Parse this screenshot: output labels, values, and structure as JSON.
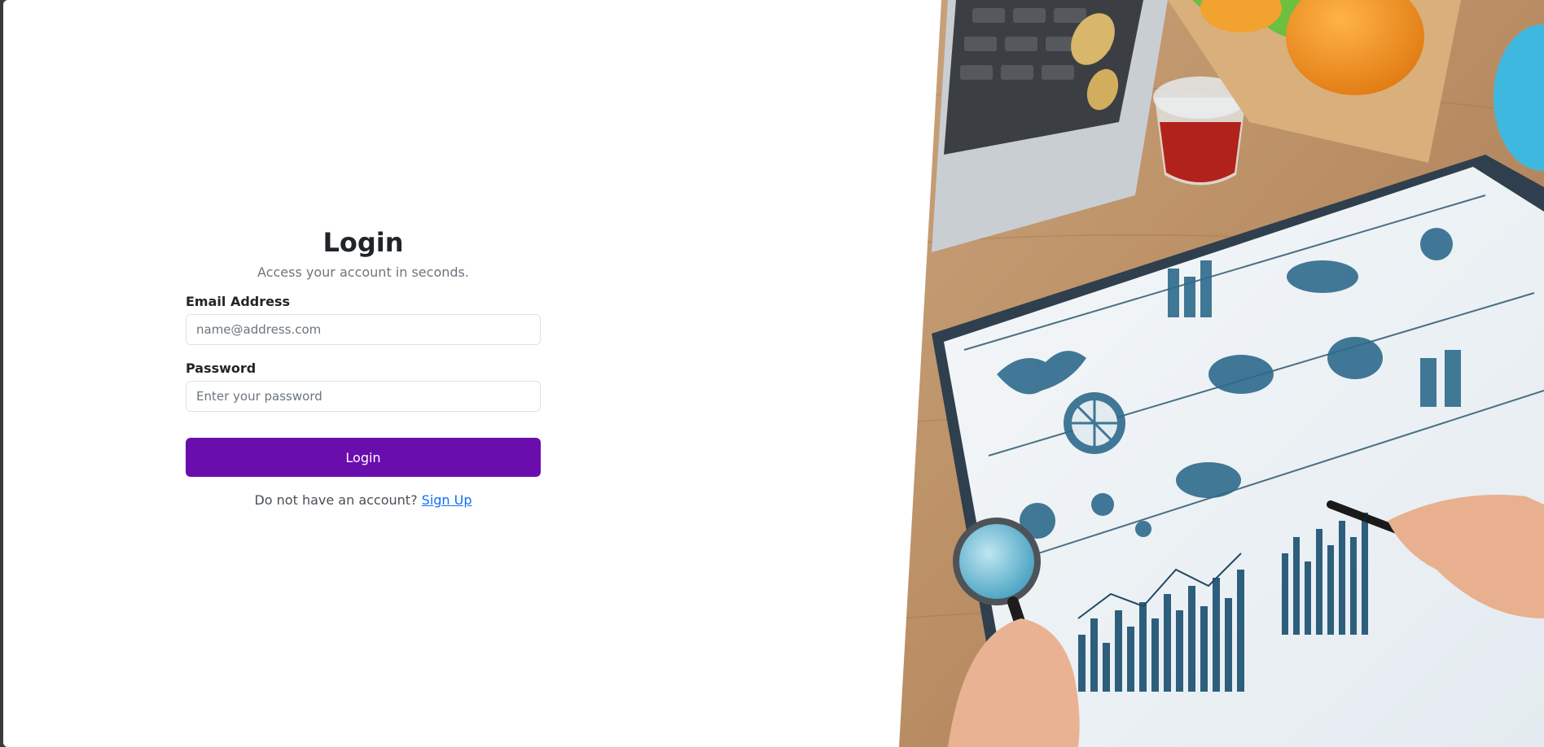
{
  "login": {
    "title": "Login",
    "subtitle": "Access your account in seconds.",
    "email": {
      "label": "Email Address",
      "placeholder": "name@address.com",
      "value": ""
    },
    "password": {
      "label": "Password",
      "placeholder": "Enter your password",
      "value": ""
    },
    "submit_label": "Login",
    "signup_prompt": "Do not have an account?",
    "signup_link": "Sign Up"
  },
  "colors": {
    "accent": "#6a0dad",
    "link": "#0d6efd",
    "text": "#212529",
    "muted": "#6c757d"
  },
  "hero": {
    "icon": "nutrition-illustration-image"
  }
}
